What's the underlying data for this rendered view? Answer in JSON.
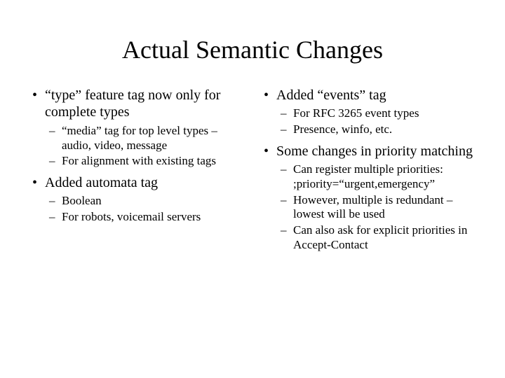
{
  "title": "Actual Semantic Changes",
  "left": {
    "items": [
      {
        "text": "“type” feature tag now only for complete types",
        "sub": [
          "“media” tag for top level types – audio, video, message",
          "For alignment with existing tags"
        ]
      },
      {
        "text": "Added automata tag",
        "sub": [
          "Boolean",
          "For robots, voicemail servers"
        ]
      }
    ]
  },
  "right": {
    "items": [
      {
        "text": "Added “events” tag",
        "sub": [
          "For RFC 3265 event types",
          "Presence, winfo, etc."
        ]
      },
      {
        "text": "Some changes in priority matching",
        "sub": [
          "Can register multiple priorities: ;priority=“urgent,emergency”",
          "However, multiple is redundant – lowest will be used",
          "Can also ask for explicit priorities in Accept-Contact"
        ]
      }
    ]
  }
}
